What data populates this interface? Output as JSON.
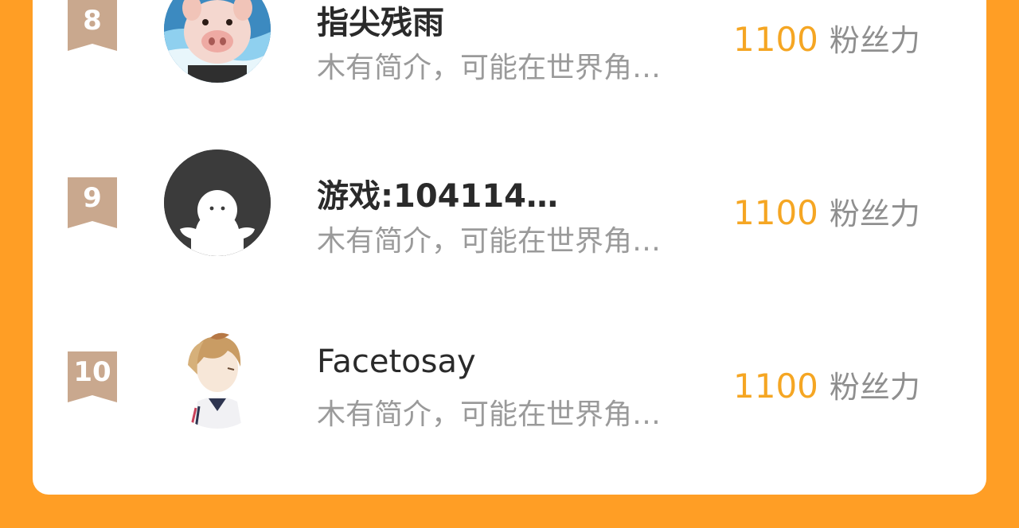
{
  "list": {
    "items": [
      {
        "rank": "8",
        "name": "指尖残雨",
        "desc": "木有简介，可能在世界角…",
        "fans": "1100",
        "fans_label": "粉丝力",
        "avatar_icon": "pig-avatar-icon"
      },
      {
        "rank": "9",
        "name": "游戏:104114…",
        "desc": "木有简介，可能在世界角…",
        "fans": "1100",
        "fans_label": "粉丝力",
        "avatar_icon": "default-user-avatar-icon"
      },
      {
        "rank": "10",
        "name": "Facetosay",
        "desc": "木有简介，可能在世界角…",
        "fans": "1100",
        "fans_label": "粉丝力",
        "avatar_icon": "anime-boy-avatar-icon"
      }
    ]
  },
  "colors": {
    "background": "#FF9E25",
    "card": "#ffffff",
    "rank_badge": "#C9A88E",
    "fans_number": "#F5A623",
    "muted_text": "#9a9a9a"
  }
}
